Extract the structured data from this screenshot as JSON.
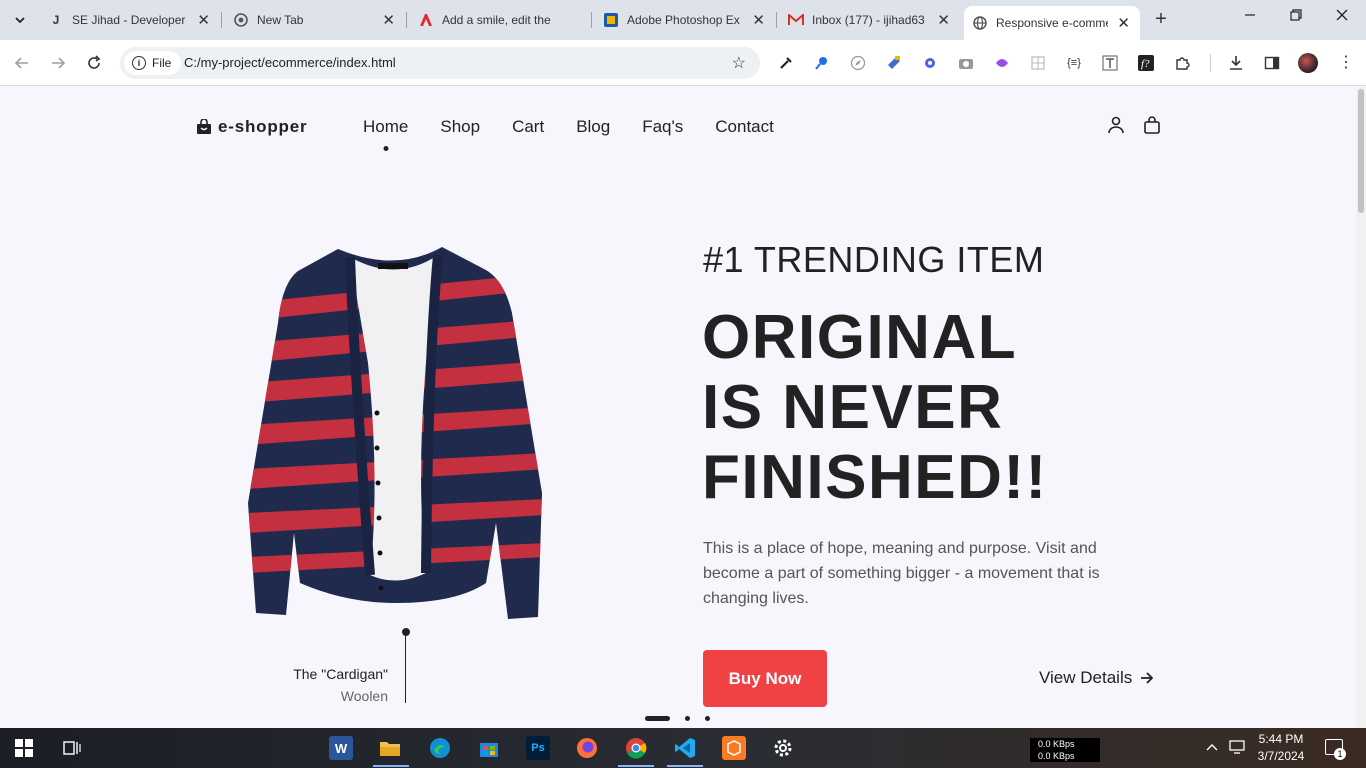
{
  "browser": {
    "tabs": [
      {
        "title": "SE Jihad - Developer",
        "favicon": "J"
      },
      {
        "title": "New Tab",
        "favicon": "chrome"
      },
      {
        "title": "Add a smile, edit the",
        "favicon": "adobe"
      },
      {
        "title": "Adobe Photoshop Ex",
        "favicon": "photoshop"
      },
      {
        "title": "Inbox (177) - ijihad63",
        "favicon": "M"
      },
      {
        "title": "Responsive e-comme",
        "favicon": "globe"
      }
    ],
    "site_chip": "File",
    "url": "C:/my-project/ecommerce/index.html"
  },
  "page": {
    "brand": "e-shopper",
    "nav": [
      "Home",
      "Shop",
      "Cart",
      "Blog",
      "Faq's",
      "Contact"
    ],
    "hero": {
      "kicker": "#1 TRENDING ITEM",
      "title_lines": [
        "ORIGINAL",
        "IS NEVER",
        "FINISHED!!"
      ],
      "description": "This is a place of hope, meaning and purpose. Visit and become a part of something bigger - a movement that is changing lives.",
      "buy_label": "Buy Now",
      "details_label": "View Details"
    },
    "product": {
      "name": "The \"Cardigan\"",
      "material": "Woolen"
    },
    "colors": {
      "accent": "#f04145",
      "cardigan_navy": "#1f2a4d",
      "cardigan_red": "#c4303f"
    }
  },
  "taskbar": {
    "net_up": "0.0 KBps",
    "net_down": "0.0 KBps",
    "time": "5:44 PM",
    "date": "3/7/2024",
    "notifications": "1"
  }
}
